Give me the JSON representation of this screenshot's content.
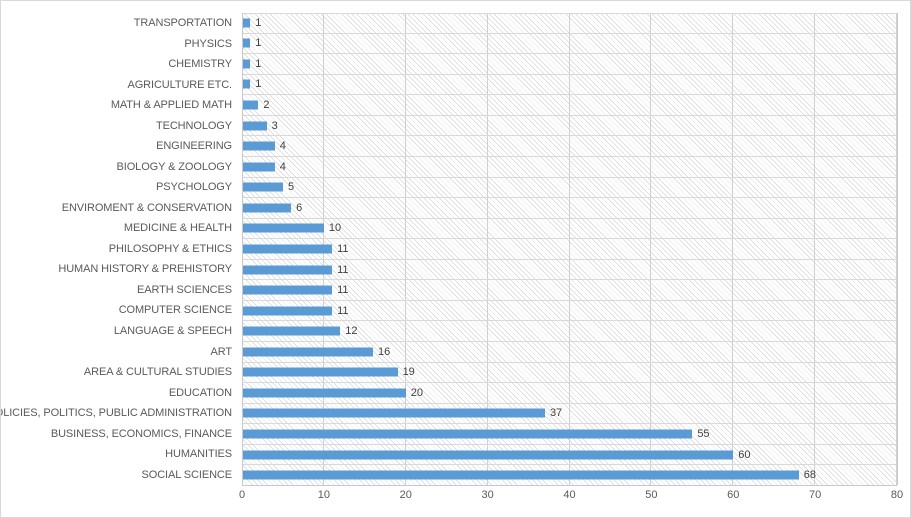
{
  "chart": {
    "type": "bar",
    "title": "",
    "accent_color": "#5b9bd5",
    "axis_label_color": "#5a5a5a",
    "data_label_color": "#3f3f3f",
    "gridline_color": "#d9d9d9",
    "plot_background": "diagonal-hatch-light-gray",
    "legend": "none",
    "orientation": "horizontal"
  },
  "chart_data": {
    "type": "bar",
    "title": "",
    "xlabel": "",
    "ylabel": "",
    "xlim": [
      0,
      80
    ],
    "xticks": [
      0,
      10,
      20,
      30,
      40,
      50,
      60,
      70,
      80
    ],
    "grid": true,
    "legend_position": "none",
    "orientation": "horizontal",
    "categories": [
      "TRANSPORTATION",
      "PHYSICS",
      "CHEMISTRY",
      "AGRICULTURE ETC.",
      "MATH & APPLIED MATH",
      "TECHNOLOGY",
      "ENGINEERING",
      "BIOLOGY & ZOOLOGY",
      "PSYCHOLOGY",
      "ENVIROMENT & CONSERVATION",
      "MEDICINE & HEALTH",
      "PHILOSOPHY & ETHICS",
      "HUMAN HISTORY & PREHISTORY",
      "EARTH SCIENCES",
      "COMPUTER SCIENCE",
      "LANGUAGE & SPEECH",
      "ART",
      "AREA & CULTURAL STUDIES",
      "EDUCATION",
      "POLICIES, POLITICS, PUBLIC ADMINISTRATION",
      "BUSINESS, ECONOMICS, FINANCE",
      "HUMANITIES",
      "SOCIAL SCIENCE"
    ],
    "values": [
      1,
      1,
      1,
      1,
      2,
      3,
      4,
      4,
      5,
      6,
      10,
      11,
      11,
      11,
      11,
      12,
      16,
      19,
      20,
      37,
      55,
      60,
      68
    ],
    "data_labels": [
      "1",
      "1",
      "1",
      "1",
      "2",
      "3",
      "4",
      "4",
      "5",
      "6",
      "10",
      "11",
      "11",
      "11",
      "11",
      "12",
      "16",
      "19",
      "20",
      "37",
      "55",
      "60",
      "68"
    ],
    "xtick_labels": [
      "0",
      "10",
      "20",
      "30",
      "40",
      "50",
      "60",
      "70",
      "80"
    ]
  }
}
